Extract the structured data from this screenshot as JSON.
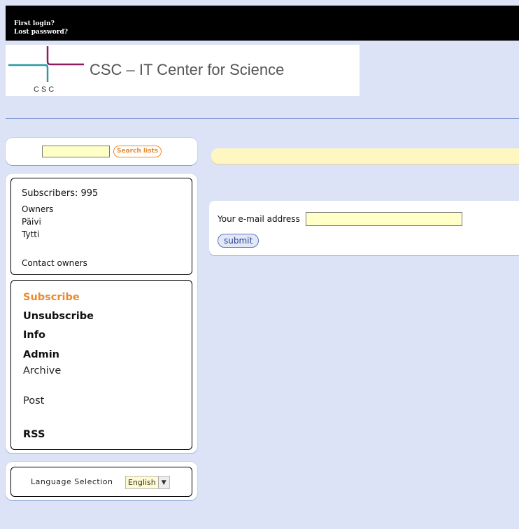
{
  "top_links": {
    "first_login": "First login?",
    "lost_password": "Lost password?"
  },
  "logo": {
    "mark_text": "CSC",
    "title": "CSC – IT Center for Science"
  },
  "search": {
    "value": "",
    "button_label": "Search lists"
  },
  "info": {
    "subscribers": "Subscribers: 995",
    "owners_label": "Owners",
    "owners": [
      "Päivi",
      "Tytti"
    ],
    "contact_owners": "Contact owners"
  },
  "menu": {
    "subscribe": "Subscribe",
    "unsubscribe": "Unsubscribe",
    "info": "Info",
    "admin": "Admin",
    "archive": "Archive",
    "post": "Post",
    "rss": "RSS"
  },
  "form": {
    "email_label": "Your e-mail address",
    "email_value": "",
    "submit_label": "submit"
  },
  "language": {
    "label": "Language Selection",
    "selected": "English"
  },
  "colors": {
    "accent": "#e98a2f",
    "background": "#dde3f6",
    "logo_purple": "#8c1d63",
    "logo_teal": "#2a9aa3"
  }
}
